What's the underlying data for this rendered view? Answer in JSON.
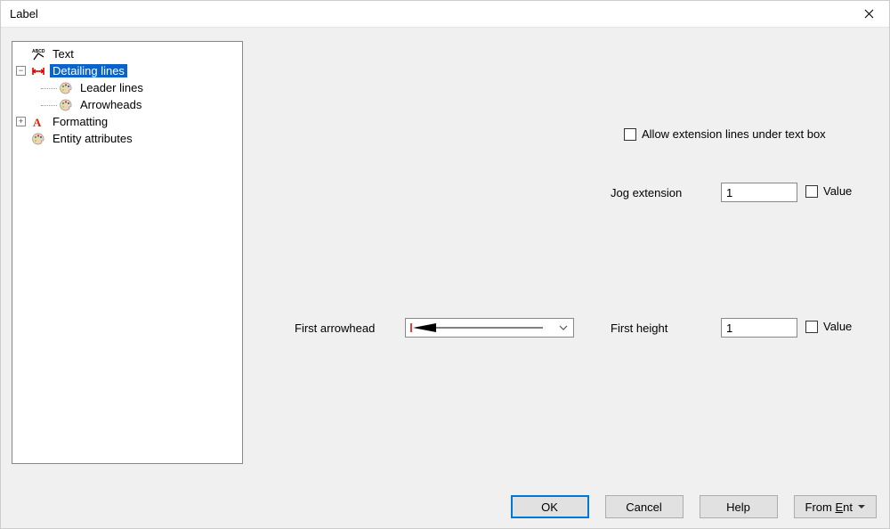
{
  "window": {
    "title": "Label"
  },
  "tree": {
    "items": {
      "text": "Text",
      "detailing": "Detailing lines",
      "leader": "Leader lines",
      "arrowheads": "Arrowheads",
      "formatting": "Formatting",
      "entity": "Entity attributes"
    }
  },
  "form": {
    "allowExt": "Allow extension lines under text box",
    "jogExtLabel": "Jog extension",
    "jogExtValue": "1",
    "valueLabel": "Value",
    "firstArrowheadLabel": "First arrowhead",
    "firstHeightLabel": "First height",
    "firstHeightValue": "1"
  },
  "buttons": {
    "ok": "OK",
    "cancel": "Cancel",
    "help": "Help",
    "fromEntPrefix": "From ",
    "fromEntKey": "E",
    "fromEntSuffix": "nt"
  }
}
